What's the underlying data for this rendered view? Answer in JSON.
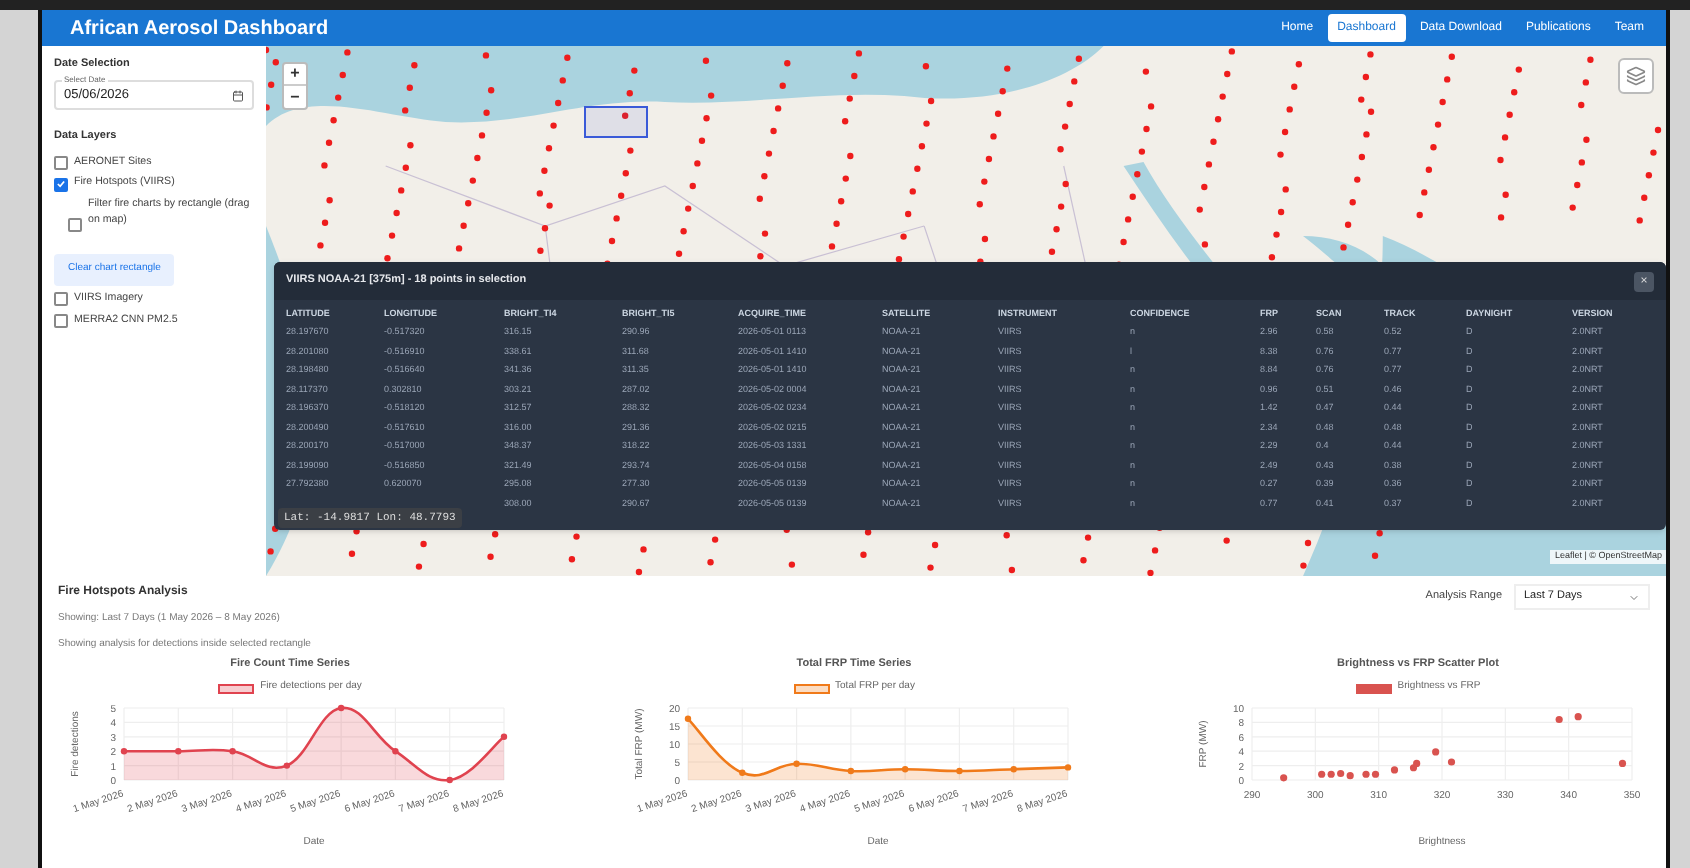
{
  "header": {
    "title": "African Aerosol Dashboard",
    "nav": [
      {
        "label": "Home",
        "selected": false
      },
      {
        "label": "Dashboard",
        "selected": true
      },
      {
        "label": "Data Download",
        "selected": false
      },
      {
        "label": "Publications",
        "selected": false
      },
      {
        "label": "Team",
        "selected": false
      }
    ]
  },
  "sidebar": {
    "date_section": "Date Selection",
    "date_field": {
      "label": "Select Date",
      "value": "05/06/2026"
    },
    "layers_section": "Data Layers",
    "layers": [
      {
        "label": "AERONET Sites",
        "checked": false
      },
      {
        "label": "Fire Hotspots (VIIRS)",
        "checked": true,
        "children": [
          {
            "label": "Filter fire charts by rectangle (drag on map)",
            "checked": false
          }
        ],
        "action": "Clear chart rectangle"
      },
      {
        "label": "VIIRS Imagery",
        "checked": false
      },
      {
        "label": "MERRA2 CNN PM2.5",
        "checked": false
      }
    ]
  },
  "map": {
    "zoom_in": "+",
    "zoom_out": "−",
    "attribution": "Leaflet | © OpenStreetMap",
    "cursor_readout": "Lat: -14.9817 Lon: 48.7793",
    "table": {
      "title": "VIIRS NOAA-21 [375m] - 18 points in selection",
      "close": "×",
      "columns": [
        "LATITUDE",
        "LONGITUDE",
        "BRIGHT_TI4",
        "BRIGHT_TI5",
        "ACQUIRE_TIME",
        "SATELLITE",
        "INSTRUMENT",
        "CONFIDENCE",
        "FRP",
        "SCAN",
        "TRACK",
        "DAYNIGHT",
        "VERSION"
      ],
      "rows": [
        [
          "28.197670",
          "-0.517320",
          "316.15",
          "290.96",
          "2026-05-01 0113",
          "NOAA-21",
          "VIIRS",
          "n",
          "2.96",
          "0.58",
          "0.52",
          "D",
          "2.0NRT"
        ],
        [
          "28.201080",
          "-0.516910",
          "338.61",
          "311.68",
          "2026-05-01 1410",
          "NOAA-21",
          "VIIRS",
          "l",
          "8.38",
          "0.76",
          "0.77",
          "D",
          "2.0NRT"
        ],
        [
          "28.198480",
          "-0.516640",
          "341.36",
          "311.35",
          "2026-05-01 1410",
          "NOAA-21",
          "VIIRS",
          "n",
          "8.84",
          "0.76",
          "0.77",
          "D",
          "2.0NRT"
        ],
        [
          "28.117370",
          "0.302810",
          "303.21",
          "287.02",
          "2026-05-02 0004",
          "NOAA-21",
          "VIIRS",
          "n",
          "0.96",
          "0.51",
          "0.46",
          "D",
          "2.0NRT"
        ],
        [
          "28.196370",
          "-0.518120",
          "312.57",
          "288.32",
          "2026-05-02 0234",
          "NOAA-21",
          "VIIRS",
          "n",
          "1.42",
          "0.47",
          "0.44",
          "D",
          "2.0NRT"
        ],
        [
          "28.200490",
          "-0.517610",
          "316.00",
          "291.36",
          "2026-05-02 0215",
          "NOAA-21",
          "VIIRS",
          "n",
          "2.34",
          "0.48",
          "0.48",
          "D",
          "2.0NRT"
        ],
        [
          "28.200170",
          "-0.517000",
          "348.37",
          "318.22",
          "2026-05-03 1331",
          "NOAA-21",
          "VIIRS",
          "n",
          "2.29",
          "0.4",
          "0.44",
          "D",
          "2.0NRT"
        ],
        [
          "28.199090",
          "-0.516850",
          "321.49",
          "293.74",
          "2026-05-04 0158",
          "NOAA-21",
          "VIIRS",
          "n",
          "2.49",
          "0.43",
          "0.38",
          "D",
          "2.0NRT"
        ],
        [
          "27.792380",
          "0.620070",
          "295.08",
          "277.30",
          "2026-05-05 0139",
          "NOAA-21",
          "VIIRS",
          "n",
          "0.27",
          "0.39",
          "0.36",
          "D",
          "2.0NRT"
        ],
        [
          null,
          null,
          "308.00",
          "290.67",
          "2026-05-05 0139",
          "NOAA-21",
          "VIIRS",
          "n",
          "0.77",
          "0.41",
          "0.37",
          "D",
          "2.0NRT"
        ]
      ]
    }
  },
  "analysis": {
    "title": "Fire Hotspots Analysis",
    "range_label": "Analysis Range",
    "range_value": "Last 7 Days",
    "showing": "Showing: Last 7 Days (1 May 2026 – 8 May 2026)",
    "note": "Showing analysis for detections inside selected rectangle",
    "charts": [
      {
        "chart_data": {
          "type": "area",
          "title": "Fire Count Time Series",
          "xlabel": "Date",
          "ylabel": "Fire detections",
          "categories": [
            "1 May 2026",
            "2 May 2026",
            "3 May 2026",
            "4 May 2026",
            "5 May 2026",
            "6 May 2026",
            "7 May 2026",
            "8 May 2026"
          ],
          "ylim": [
            0,
            5
          ],
          "yticks": [
            0,
            1,
            2,
            3,
            4,
            5
          ],
          "grid": true,
          "series": [
            {
              "name": "Fire detections per day",
              "color": "#e0434f",
              "values": [
                2,
                2,
                2,
                1,
                5,
                2,
                0,
                3
              ]
            }
          ]
        }
      },
      {
        "chart_data": {
          "type": "area",
          "title": "Total FRP Time Series",
          "xlabel": "Date",
          "ylabel": "Total FRP (MW)",
          "categories": [
            "1 May 2026",
            "2 May 2026",
            "3 May 2026",
            "4 May 2026",
            "5 May 2026",
            "6 May 2026",
            "7 May 2026",
            "8 May 2026"
          ],
          "ylim": [
            0,
            20
          ],
          "yticks": [
            0,
            5,
            10,
            15,
            20
          ],
          "grid": true,
          "series": [
            {
              "name": "Total FRP per day",
              "color": "#f07a1a",
              "values": [
                17,
                2,
                4.5,
                2.5,
                3,
                2.5,
                3,
                3.5
              ]
            }
          ]
        }
      },
      {
        "chart_data": {
          "type": "scatter",
          "title": "Brightness vs FRP Scatter Plot",
          "xlabel": "Brightness",
          "ylabel": "FRP (MW)",
          "xlim": [
            290,
            350
          ],
          "ylim": [
            0,
            10
          ],
          "xticks": [
            290,
            300,
            310,
            320,
            330,
            340,
            350
          ],
          "yticks": [
            0,
            2,
            4,
            6,
            8,
            10
          ],
          "grid": true,
          "x": [
            295,
            301,
            302.5,
            304,
            305.5,
            308,
            309.5,
            312.5,
            315.5,
            316,
            319,
            321.5,
            338.5,
            341.5,
            348.5
          ],
          "series": [
            {
              "name": "Brightness vs FRP",
              "color": "#d9534f",
              "values": [
                0.3,
                0.8,
                0.8,
                0.9,
                0.6,
                0.8,
                0.8,
                1.4,
                1.7,
                2.3,
                3.9,
                2.5,
                8.4,
                8.8,
                2.3
              ]
            }
          ]
        }
      }
    ]
  }
}
